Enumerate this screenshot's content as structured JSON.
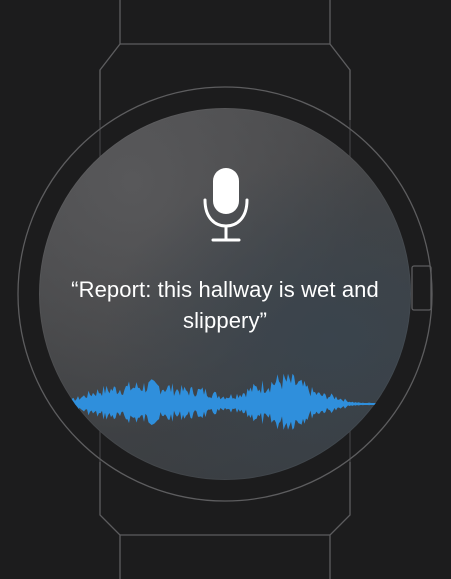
{
  "assistant": {
    "transcript": "“Report: this hallway is wet and slippery”"
  },
  "icons": {
    "microphone": "microphone-icon"
  },
  "colors": {
    "background": "#1c1c1d",
    "outline": "#5d5d5f",
    "waveform": "#2f8fdc",
    "text": "#ffffff"
  }
}
